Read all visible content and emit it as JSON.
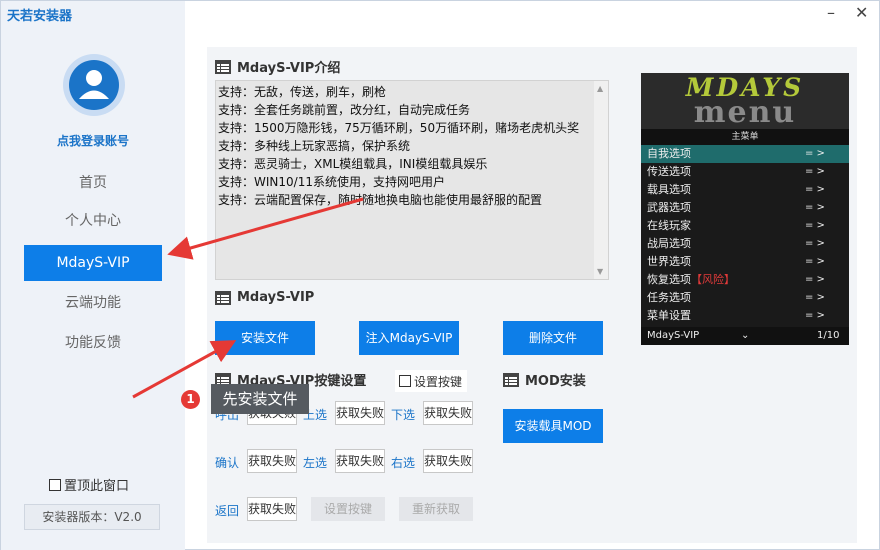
{
  "app": {
    "title": "天若安装器",
    "minimize_glyph": "–",
    "close_glyph": "✕"
  },
  "sidebar": {
    "login_text": "点我登录账号",
    "nav": [
      {
        "label": "首页"
      },
      {
        "label": "个人中心"
      },
      {
        "label": "MdayS-VIP",
        "active": true
      },
      {
        "label": "云端功能"
      },
      {
        "label": "功能反馈"
      }
    ],
    "pin_label": "置顶此窗口",
    "version": "安装器版本：V2.0"
  },
  "intro": {
    "title": "MdayS-VIP介绍",
    "lines": [
      "支持：无敌，传送，刷车，刷枪",
      "支持：全套任务跳前置，改分红，自动完成任务",
      "支持：1500万隐形钱，75万循环刷，50万循环刷，赌场老虎机头奖",
      "支持：多种线上玩家恶搞，保护系统",
      "支持：恶灵骑士，XML模组载具，INI模组载具娱乐",
      "支持：WIN10/11系统使用，支持网吧用户",
      "支持：云端配置保存，随时随地换电脑也能使用最舒服的配置"
    ]
  },
  "mdays": {
    "title": "MdayS-VIP",
    "install_btn": "安装文件",
    "inject_btn": "注入MdayS-VIP",
    "delete_btn": "删除文件"
  },
  "hotkeys": {
    "title": "MdayS-VIP按键设置",
    "set_key_label": "设置按键",
    "labels": [
      "呼出",
      "上选",
      "下选",
      "确认",
      "左选",
      "右选",
      "返回"
    ],
    "fail_text": "获取失败",
    "set_key_btn": "设置按键",
    "reget_btn": "重新获取"
  },
  "mod": {
    "title": "MOD安装",
    "vehicle_btn": "安装载具MOD"
  },
  "menu_preview": {
    "logo_top": "MDAYS",
    "logo_bottom": "menu",
    "header": "主菜单",
    "arrow": "= >",
    "items": [
      {
        "label": "自我选项",
        "selected": true
      },
      {
        "label": "传送选项"
      },
      {
        "label": "载具选项"
      },
      {
        "label": "武器选项"
      },
      {
        "label": "在线玩家"
      },
      {
        "label": "战局选项"
      },
      {
        "label": "世界选项"
      },
      {
        "label": "恢复选项",
        "tag": "【风险】"
      },
      {
        "label": "任务选项"
      },
      {
        "label": "菜单设置"
      }
    ],
    "footer_left": "MdayS-VIP",
    "footer_mid": "⌄",
    "footer_right": "1/10"
  },
  "annotation": {
    "badge": "1",
    "tooltip": "先安装文件"
  },
  "colors": {
    "accent": "#0d7ee8",
    "arrow": "#e53935",
    "sidebar_bg": "#eef2f8"
  }
}
